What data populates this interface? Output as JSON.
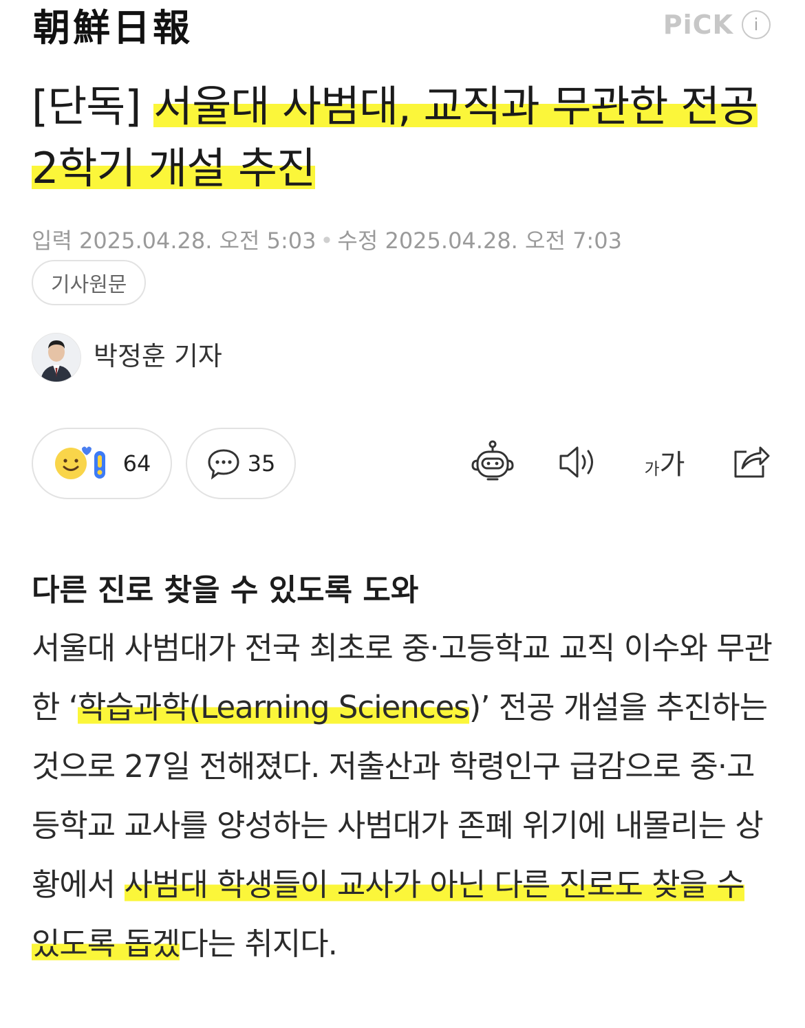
{
  "header": {
    "logo_text": "朝鮮日報",
    "pick_label": "PiCK",
    "info_icon": "i"
  },
  "article": {
    "title_prefix": "[단독] ",
    "title_highlight": "서울대 사범대, 교직과 무관한 전공 2학기 개설 추진",
    "published": "입력 2025.04.28. 오전 5:03",
    "modified": "수정 2025.04.28. 오전 7:03",
    "original_link_label": "기사원문",
    "reporter_name": "박정훈 기자",
    "subheading": "다른 진로 찾을 수 있도록 도와",
    "body_part1": "서울대 사범대가 전국 최초로 중·고등학교 교직 이수와 무관한 ‘",
    "body_hl1": "학습과학(Learning Sciences",
    "body_part2": ")’ 전공 개설을 추진하는 것으로 27일 전해졌다. 저출산과 학령인구 급감으로 중·고등학교 교사를 양성하는 사범대가 존폐 위기에 내몰리는 상황에서 ",
    "body_hl2": "사범대 학생들이 교사가 아닌 다른 진로도 찾을 수 있도록 돕겠",
    "body_part3": "다는 취지다."
  },
  "actions": {
    "reaction_count": "64",
    "comment_count": "35",
    "font_size_label_small": "가",
    "font_size_label_large": "가"
  },
  "colors": {
    "highlight": "#fbf63a",
    "meta_text": "#9a9a9a",
    "pick_text": "#c7c7c7"
  }
}
